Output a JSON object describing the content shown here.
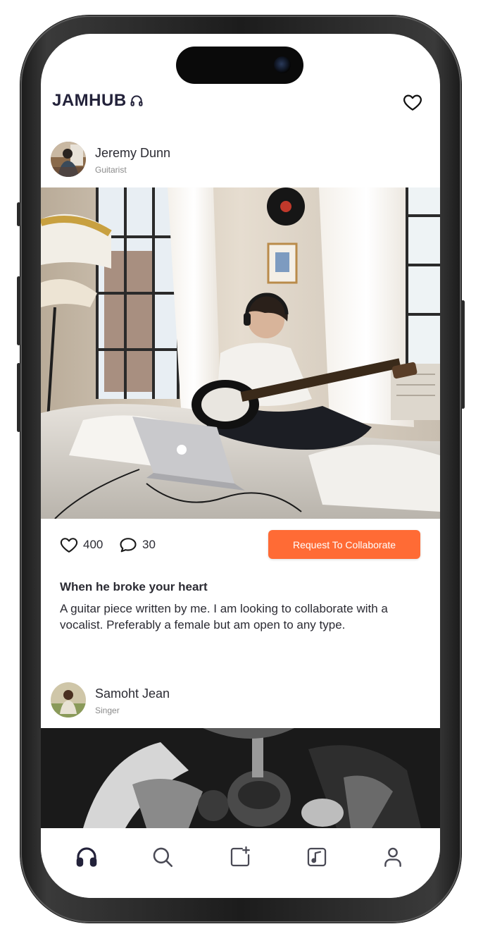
{
  "app": {
    "logo_text": "JAMHUB",
    "logo_icon": "headphones-icon",
    "accent_color": "#ff6b35",
    "text_color": "#2b2b33"
  },
  "header": {
    "favorites_icon": "heart-icon"
  },
  "posts": [
    {
      "username": "Jeremy Dunn",
      "role": "Guitarist",
      "likes": "400",
      "comments": "30",
      "collab_label": "Request To Collaborate",
      "title": "When he broke your heart",
      "description": "A guitar piece written by me. I am looking to collaborate with a vocalist. Preferably a female but am open to any type."
    },
    {
      "username": "Samoht Jean",
      "role": "Singer"
    }
  ],
  "tabbar": {
    "items": [
      {
        "icon": "headphones-icon",
        "active": true
      },
      {
        "icon": "search-icon",
        "active": false
      },
      {
        "icon": "add-post-icon",
        "active": false
      },
      {
        "icon": "music-note-icon",
        "active": false
      },
      {
        "icon": "profile-icon",
        "active": false
      }
    ]
  }
}
